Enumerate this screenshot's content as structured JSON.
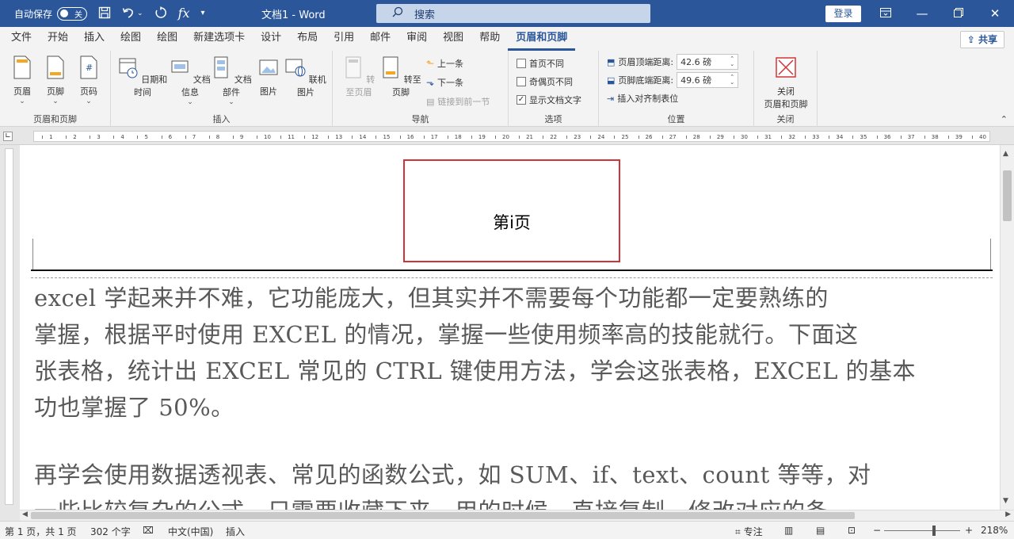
{
  "titlebar": {
    "autosave_label": "自动保存",
    "autosave_state": "关",
    "save_icon": "save-icon",
    "undo_icon": "undo-icon",
    "redo_icon": "redo-icon",
    "formula_icon": "fx",
    "doc_title": "文档1 - Word",
    "search_placeholder": "搜索",
    "signin_label": "登录",
    "ribbon_display_icon": "ribbon-display-icon",
    "minimize_icon": "minimize-icon",
    "restore_icon": "restore-icon",
    "close_icon": "close-icon"
  },
  "tabs": [
    "文件",
    "开始",
    "插入",
    "绘图",
    "绘图",
    "新建选项卡",
    "设计",
    "布局",
    "引用",
    "邮件",
    "审阅",
    "视图",
    "帮助",
    "页眉和页脚"
  ],
  "active_tab_index": 13,
  "share_label": "共享",
  "ribbon": {
    "groups": {
      "header_footer": {
        "label": "页眉和页脚",
        "buttons": [
          "页眉",
          "页脚",
          "页码"
        ]
      },
      "insert": {
        "label": "插入",
        "buttons": [
          "日期和时间",
          "文档信息",
          "文档部件",
          "图片",
          "联机图片"
        ]
      },
      "navigation": {
        "label": "导航",
        "buttons": [
          "转至页眉",
          "转至页脚"
        ],
        "prev_label": "上一条",
        "next_label": "下一条",
        "link_label": "链接到前一节"
      },
      "options": {
        "label": "选项",
        "items": [
          {
            "label": "首页不同",
            "checked": false
          },
          {
            "label": "奇偶页不同",
            "checked": false
          },
          {
            "label": "显示文档文字",
            "checked": true
          }
        ]
      },
      "position": {
        "label": "位置",
        "header_dist_label": "页眉顶端距离:",
        "header_dist_value": "42.6 磅",
        "footer_dist_label": "页脚底端距离:",
        "footer_dist_value": "49.6 磅",
        "align_tab_label": "插入对齐制表位"
      },
      "close": {
        "label": "关闭",
        "button_label_1": "关闭",
        "button_label_2": "页眉和页脚"
      }
    }
  },
  "ruler_numbers": [
    "1",
    "2",
    "3",
    "4",
    "5",
    "6",
    "7",
    "8",
    "9",
    "10",
    "11",
    "12",
    "13",
    "14",
    "15",
    "16",
    "17",
    "18",
    "19",
    "20",
    "21",
    "22",
    "23",
    "24",
    "25",
    "26",
    "27",
    "28",
    "29",
    "30",
    "31",
    "32",
    "33",
    "34",
    "35",
    "36",
    "37",
    "38",
    "39",
    "40"
  ],
  "document": {
    "header_text": "第i页",
    "paragraph1": [
      "excel 学起来并不难，它功能庞大，但其实并不需要每个功能都一定要熟练的",
      "掌握，根据平时使用 EXCEL 的情况，掌握一些使用频率高的技能就行。下面这",
      "张表格，统计出 EXCEL 常见的 CTRL 键使用方法，学会这张表格，EXCEL 的基本",
      "功也掌握了 50%。"
    ],
    "paragraph2": [
      "再学会使用数据透视表、常见的函数公式，如 SUM、if、text、count 等等，对",
      "一些比较复杂的公式，只需要收藏下来，用的时候，直接复制，修改对应的条"
    ]
  },
  "statusbar": {
    "page_info": "第 1 页，共 1 页",
    "word_count": "302 个字",
    "language": "中文(中国)",
    "mode": "插入",
    "focus_label": "专注",
    "zoom_minus": "−",
    "zoom_plus": "+",
    "zoom_level": "218%",
    "zoom_fraction": 0.66
  },
  "colors": {
    "titlebar_bg": "#2b579a",
    "accent": "#2b579a",
    "header_box_border": "#d13438"
  }
}
